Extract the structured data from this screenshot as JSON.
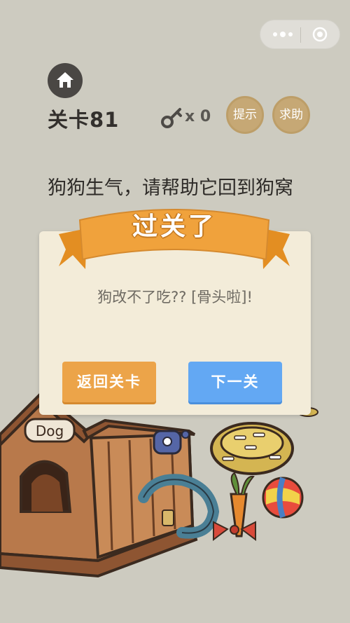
{
  "header": {
    "level_label": "关卡81",
    "key_count": "x 0",
    "hint_label": "提示",
    "help_label": "求助"
  },
  "icons": {
    "home": "home-icon",
    "key": "key-icon",
    "more": "more-dots-icon",
    "close": "target-close-icon"
  },
  "puzzle": {
    "prompt": "狗狗生气，请帮助它回到狗窝"
  },
  "dialog": {
    "title": "过关了",
    "message": "狗改不了吃?? [骨头啦]!",
    "back_label": "返回关卡",
    "next_label": "下一关"
  },
  "colors": {
    "background": "#cdcbc0",
    "dialog_bg": "#f3ecd9",
    "ribbon": "#f0a23c",
    "back_button": "#eca449",
    "next_button": "#63a8f3",
    "round_button": "#c6a875"
  }
}
